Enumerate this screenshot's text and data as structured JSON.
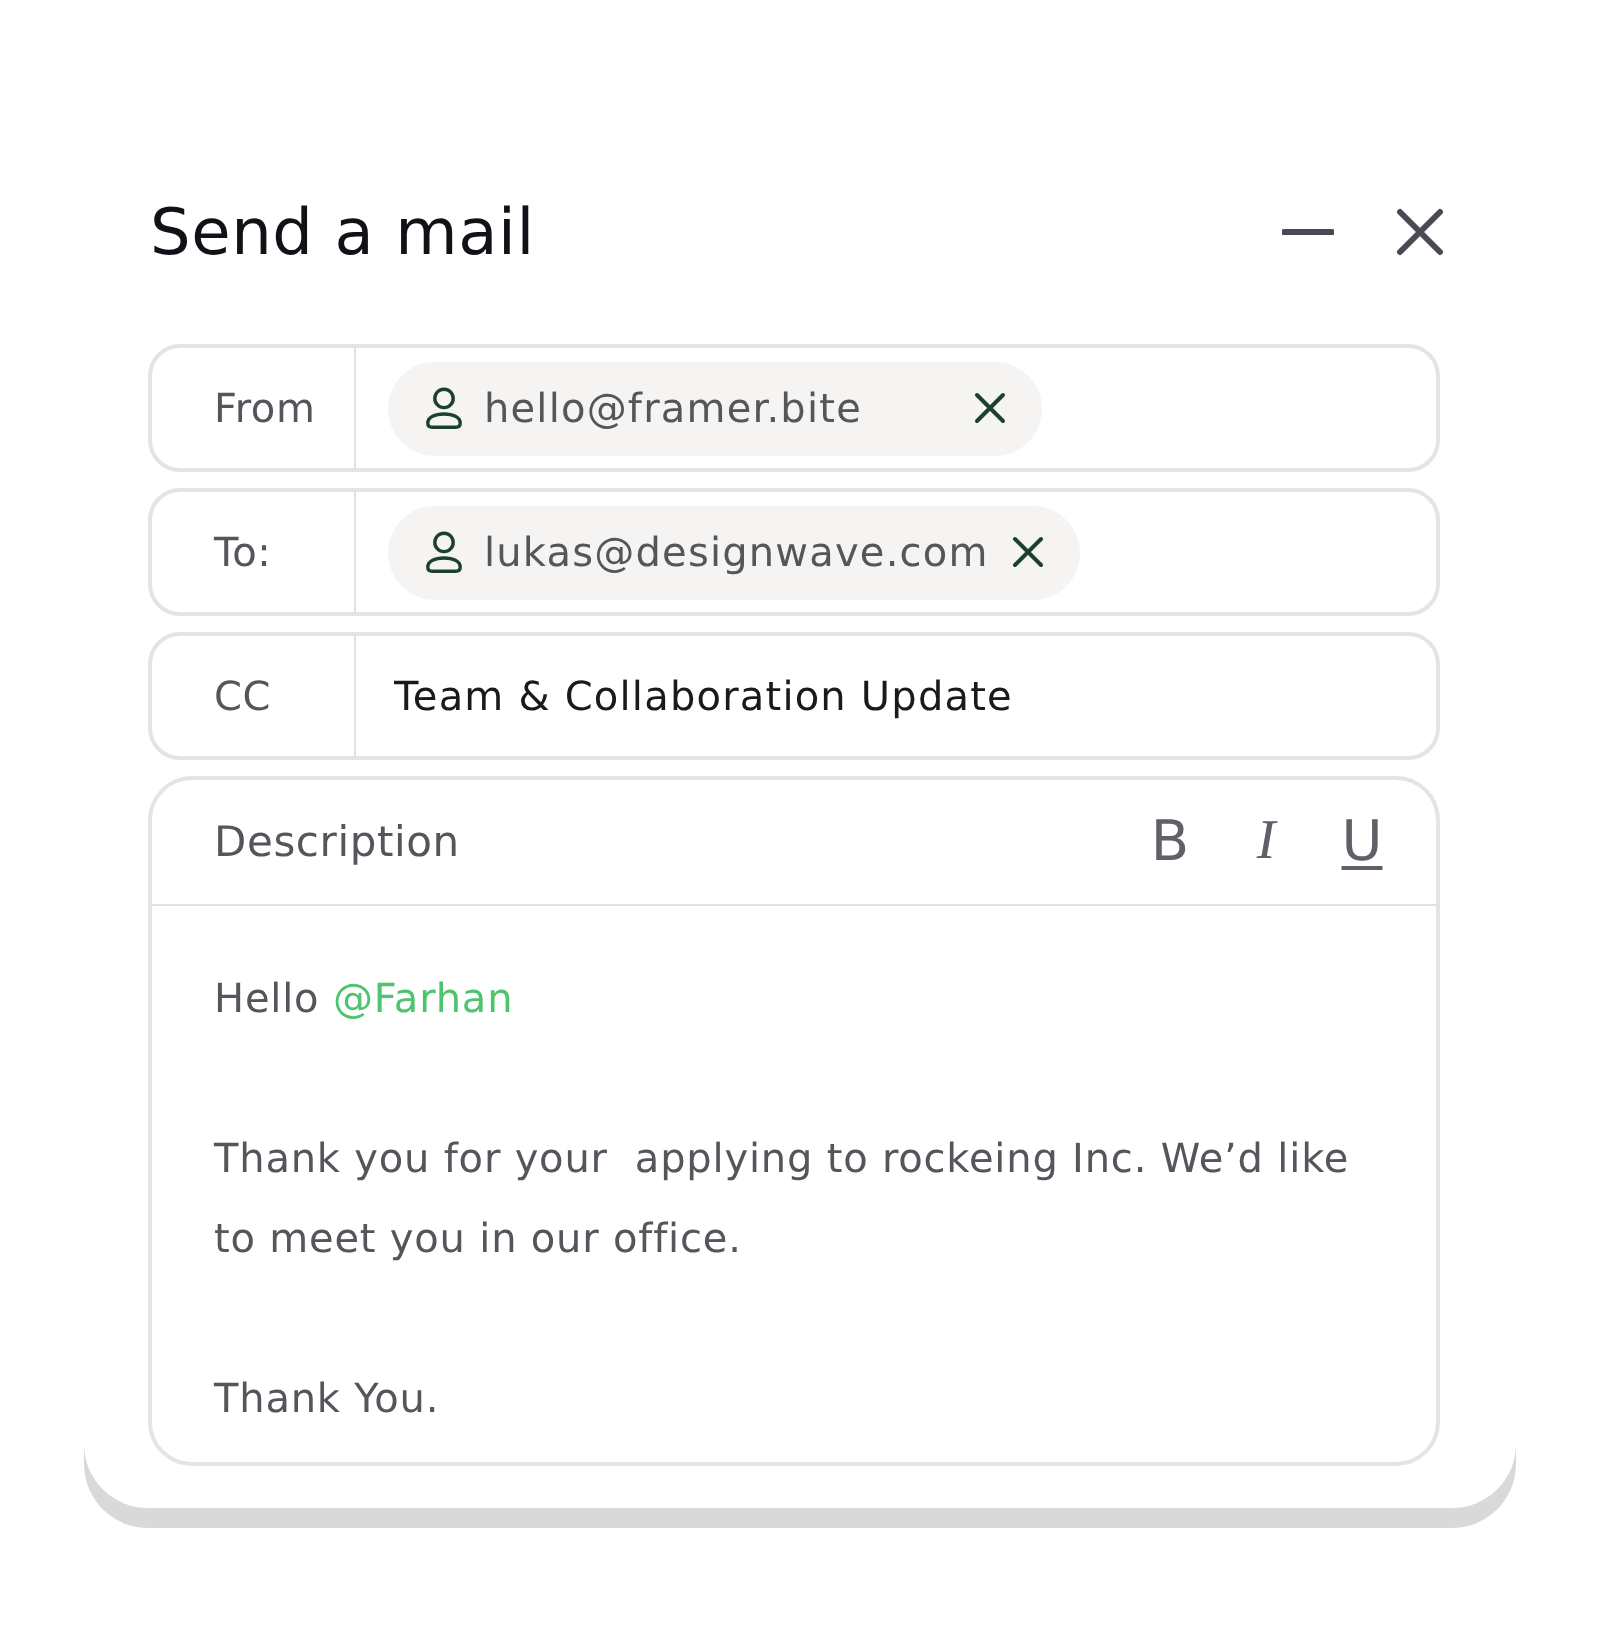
{
  "window": {
    "title": "Send a mail"
  },
  "fields": [
    {
      "kind": "chips",
      "label": "From",
      "chips": [
        "hello@framer.bite"
      ]
    },
    {
      "kind": "chips",
      "label": "To:",
      "chips": [
        "lukas@designwave.com"
      ]
    },
    {
      "kind": "text",
      "label": "CC",
      "value": "Team & Collaboration Update"
    }
  ],
  "description": {
    "label": "Description",
    "format_buttons": [
      {
        "kind": "bold",
        "label": "B"
      },
      {
        "kind": "italic",
        "label": "I"
      },
      {
        "kind": "underline",
        "label": "U"
      }
    ],
    "body": [
      {
        "kind": "greeting",
        "text": "Hello",
        "mention": "@Farhan"
      },
      {
        "kind": "text",
        "text": "Thank you for your  applying to rockeing Inc. We’d like to meet you in our office."
      },
      {
        "kind": "text",
        "text": "Thank You."
      }
    ]
  }
}
